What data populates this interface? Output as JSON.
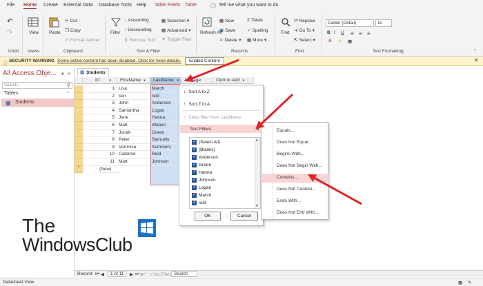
{
  "tabs": [
    "File",
    "Home",
    "Create",
    "External Data",
    "Database Tools",
    "Help",
    "Table Fields",
    "Table"
  ],
  "active_tab": "Home",
  "tell_me": "Tell me what you want to do",
  "ribbon": {
    "groups": [
      "Undo",
      "Views",
      "Clipboard",
      "Sort & Filter",
      "Records",
      "Find",
      "Text Formatting"
    ],
    "view": "View",
    "paste": "Paste",
    "cut": "Cut",
    "copy": "Copy",
    "format_painter": "Format Painter",
    "filter": "Filter",
    "ascending": "Ascending",
    "descending": "Descending",
    "remove_sort": "Remove Sort",
    "selection": "Selection",
    "advanced": "Advanced",
    "toggle_filter": "Toggle Filter",
    "refresh_all": "Refresh All",
    "new": "New",
    "save": "Save",
    "delete": "Delete",
    "totals": "Totals",
    "spelling": "Spelling",
    "more": "More",
    "find": "Find",
    "replace": "Replace",
    "go_to": "Go To",
    "select": "Select",
    "font_name": "Calibri (Detail)",
    "font_size": "11"
  },
  "security": {
    "label": "SECURITY WARNING",
    "message": "Some active content has been disabled. Click for more details.",
    "button": "Enable Content"
  },
  "nav": {
    "title": "All Access Obje...",
    "search_placeholder": "Search...",
    "section": "Tables",
    "item": "Students"
  },
  "doc_tab": "Students",
  "columns": [
    "ID",
    "FirstName",
    "LastName",
    "Average",
    "Click to Add"
  ],
  "rows": [
    {
      "id": "1",
      "first": "Lisa",
      "last": "March"
    },
    {
      "id": "2",
      "first": "ken",
      "last": "reid"
    },
    {
      "id": "3",
      "first": "John",
      "last": "Anderson"
    },
    {
      "id": "4",
      "first": "Samantha",
      "last": "Logan"
    },
    {
      "id": "5",
      "first": "Jane",
      "last": "Hanna"
    },
    {
      "id": "6",
      "first": "Matt",
      "last": "Waters"
    },
    {
      "id": "7",
      "first": "Jonah",
      "last": "Green"
    },
    {
      "id": "8",
      "first": "Peter",
      "last": "Samuels"
    },
    {
      "id": "9",
      "first": "Veronica",
      "last": "Summers"
    },
    {
      "id": "10",
      "first": "Caterine",
      "last": "Reid"
    },
    {
      "id": "11",
      "first": "Matt",
      "last": "Johnson"
    }
  ],
  "new_row": "(New)",
  "menu": {
    "sort_az": "Sort A to Z",
    "sort_za": "Sort Z to A",
    "clear_filter": "Clear filter from LastName",
    "text_filters": "Text Filters",
    "checklist": [
      "(Select All)",
      "(Blanks)",
      "Anderson",
      "Green",
      "Hanna",
      "Johnson",
      "Logan",
      "March",
      "reid"
    ],
    "ok": "OK",
    "cancel": "Cancel"
  },
  "submenu": [
    "Equals...",
    "Does Not Equal...",
    "Begins With...",
    "Does Not Begin With...",
    "Contains...",
    "Does Not Contain...",
    "Ends With...",
    "Does Not End With..."
  ],
  "logo": {
    "line1": "The",
    "line2": "WindowsClub"
  },
  "record_nav": {
    "label": "Record:",
    "position": "1 of 11",
    "filter": "No Filter",
    "search": "Search"
  },
  "status": "Datasheet View"
}
